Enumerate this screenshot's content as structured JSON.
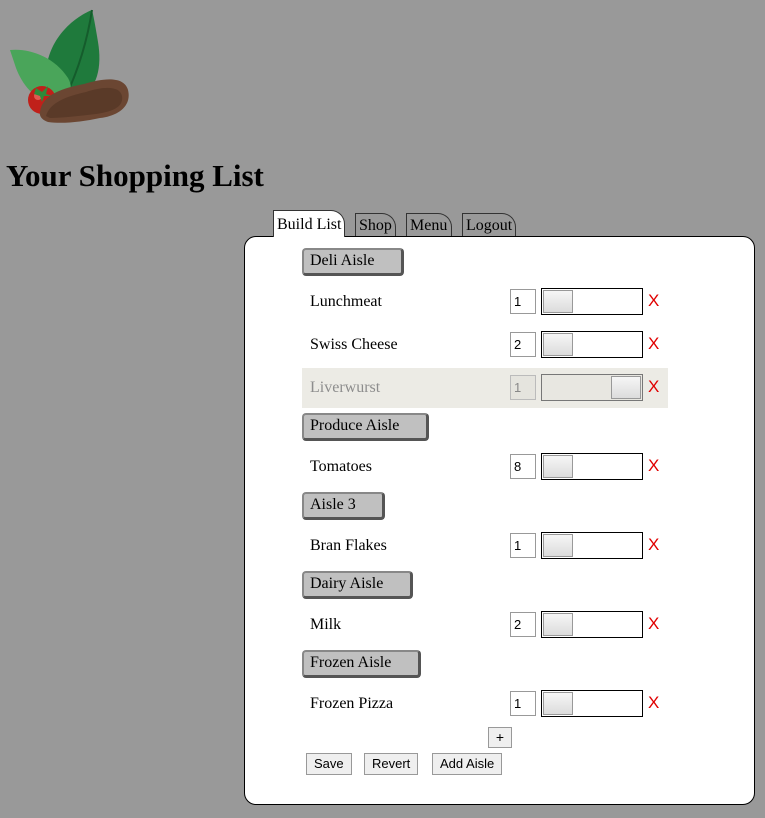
{
  "header": {
    "title": "Your Shopping List",
    "logo_icon": "vegetables-steak-logo"
  },
  "tabs": [
    {
      "label": "Build List",
      "active": true
    },
    {
      "label": "Shop",
      "active": false
    },
    {
      "label": "Menu",
      "active": false
    },
    {
      "label": "Logout",
      "active": false
    }
  ],
  "list": {
    "aisles": [
      {
        "name": "Deli Aisle",
        "items": [
          {
            "name": "Lunchmeat",
            "qty": "1",
            "included": false
          },
          {
            "name": "Swiss Cheese",
            "qty": "2",
            "included": false
          },
          {
            "name": "Liverwurst",
            "qty": "1",
            "included": true,
            "disabled": true
          }
        ]
      },
      {
        "name": "Produce Aisle",
        "items": [
          {
            "name": "Tomatoes",
            "qty": "8",
            "included": false
          }
        ]
      },
      {
        "name": "Aisle 3",
        "items": [
          {
            "name": "Bran Flakes",
            "qty": "1",
            "included": false
          }
        ]
      },
      {
        "name": "Dairy Aisle",
        "items": [
          {
            "name": "Milk",
            "qty": "2",
            "included": false
          }
        ]
      },
      {
        "name": "Frozen Aisle",
        "items": [
          {
            "name": "Frozen Pizza",
            "qty": "1",
            "included": false
          }
        ]
      }
    ],
    "remove_label": "X",
    "add_item_label": "+"
  },
  "actions": {
    "save": "Save",
    "revert": "Revert",
    "add_aisle": "Add Aisle"
  },
  "colors": {
    "background": "#999999",
    "remove": "#e00000",
    "disabled_row": "#ecebe5"
  }
}
